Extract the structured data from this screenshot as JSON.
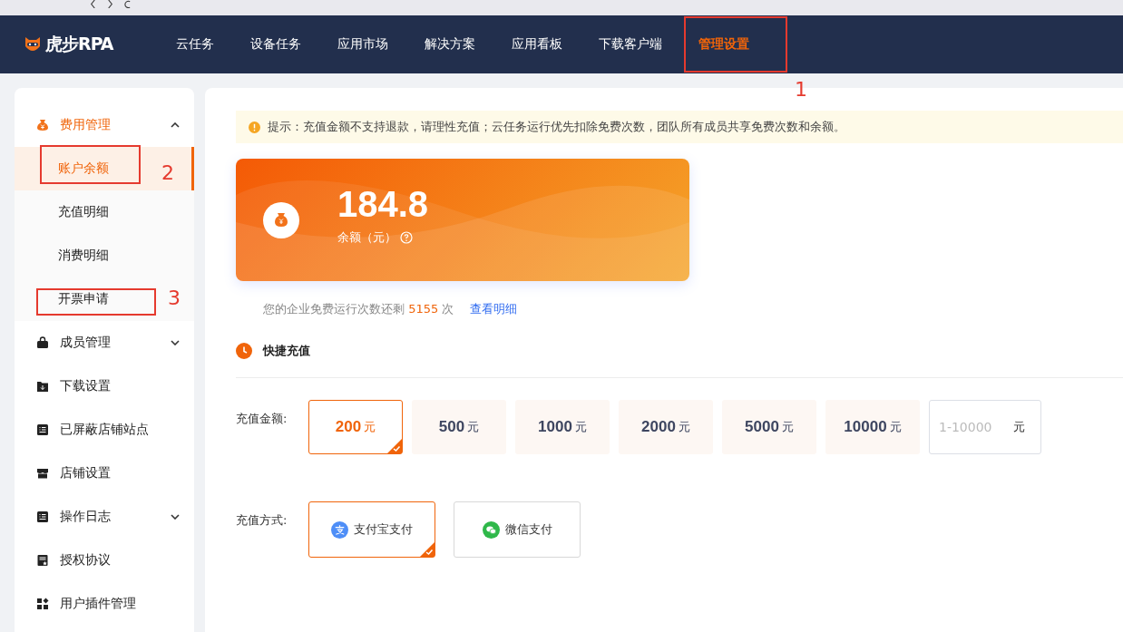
{
  "nav": {
    "logo": "虎步RPA",
    "items": [
      {
        "label": "云任务",
        "selected": false
      },
      {
        "label": "设备任务",
        "selected": false
      },
      {
        "label": "应用市场",
        "selected": false
      },
      {
        "label": "解决方案",
        "selected": false
      },
      {
        "label": "应用看板",
        "selected": false
      },
      {
        "label": "下载客户端",
        "selected": false
      },
      {
        "label": "管理设置",
        "selected": true
      }
    ]
  },
  "sidebar": {
    "items": [
      {
        "label": "费用管理",
        "expanded": true,
        "children": [
          {
            "label": "账户余额",
            "selected": true
          },
          {
            "label": "充值明细",
            "selected": false
          },
          {
            "label": "消费明细",
            "selected": false
          },
          {
            "label": "开票申请",
            "selected": false
          }
        ]
      },
      {
        "label": "成员管理",
        "expanded": false
      },
      {
        "label": "下载设置"
      },
      {
        "label": "已屏蔽店铺站点"
      },
      {
        "label": "店铺设置"
      },
      {
        "label": "操作日志",
        "expanded": false
      },
      {
        "label": "授权协议"
      },
      {
        "label": "用户插件管理"
      }
    ]
  },
  "notice": "提示：充值金额不支持退款，请理性充值；云任务运行优先扣除免费次数，团队所有成员共享免费次数和余额。",
  "balance": {
    "amount": "184.8",
    "label": "余额（元）"
  },
  "free_runs": {
    "prefix": "您的企业免费运行次数还剩",
    "count": "5155",
    "suffix": "次",
    "link": "查看明细"
  },
  "quick_recharge": {
    "title": "快捷充值",
    "amount_label": "充值金额:",
    "amounts": [
      {
        "value": "200",
        "unit": "元",
        "selected": true
      },
      {
        "value": "500",
        "unit": "元",
        "selected": false
      },
      {
        "value": "1000",
        "unit": "元",
        "selected": false
      },
      {
        "value": "2000",
        "unit": "元",
        "selected": false
      },
      {
        "value": "5000",
        "unit": "元",
        "selected": false
      },
      {
        "value": "10000",
        "unit": "元",
        "selected": false
      }
    ],
    "custom": {
      "placeholder": "1-10000",
      "unit": "元"
    },
    "method_label": "充值方式:",
    "methods": [
      {
        "label": "支付宝支付",
        "selected": true
      },
      {
        "label": "微信支付",
        "selected": false
      }
    ]
  },
  "annotations": [
    {
      "label": "1"
    },
    {
      "label": "2"
    },
    {
      "label": "3"
    }
  ]
}
